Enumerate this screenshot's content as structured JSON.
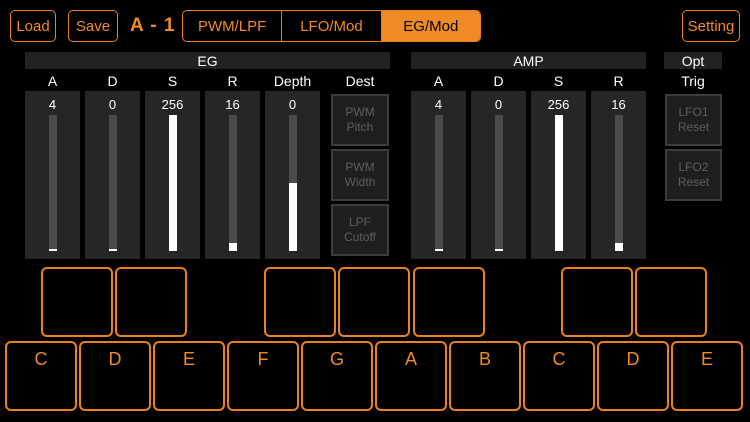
{
  "toolbar": {
    "load_label": "Load",
    "save_label": "Save",
    "preset_name": "A - 1",
    "tabs": [
      {
        "label": "PWM/LPF",
        "active": false
      },
      {
        "label": "LFO/Mod",
        "active": false
      },
      {
        "label": "EG/Mod",
        "active": true
      }
    ],
    "setting_label": "Setting"
  },
  "eg": {
    "title": "EG",
    "sliders": [
      {
        "label": "A",
        "value": "4",
        "level": 0.016
      },
      {
        "label": "D",
        "value": "0",
        "level": 0.0
      },
      {
        "label": "S",
        "value": "256",
        "level": 1.0
      },
      {
        "label": "R",
        "value": "16",
        "level": 0.0625
      },
      {
        "label": "Depth",
        "value": "0",
        "level": 0.5
      }
    ],
    "dest_label": "Dest",
    "dest_buttons": [
      "PWM\nPitch",
      "PWM\nWidth",
      "LPF\nCutoff"
    ]
  },
  "amp": {
    "title": "AMP",
    "sliders": [
      {
        "label": "A",
        "value": "4",
        "level": 0.016
      },
      {
        "label": "D",
        "value": "0",
        "level": 0.0
      },
      {
        "label": "S",
        "value": "256",
        "level": 1.0
      },
      {
        "label": "R",
        "value": "16",
        "level": 0.0625
      }
    ]
  },
  "opt": {
    "title": "Opt",
    "trig_label": "Trig",
    "buttons": [
      "LFO1\nReset",
      "LFO2\nReset"
    ]
  },
  "keyboard": {
    "white_keys": [
      "C",
      "D",
      "E",
      "F",
      "G",
      "A",
      "B",
      "C",
      "D",
      "E"
    ],
    "black_key_count": 7
  },
  "colors": {
    "accent": "#f08a24",
    "background": "#000000",
    "slider_fill": "#ffffff"
  }
}
